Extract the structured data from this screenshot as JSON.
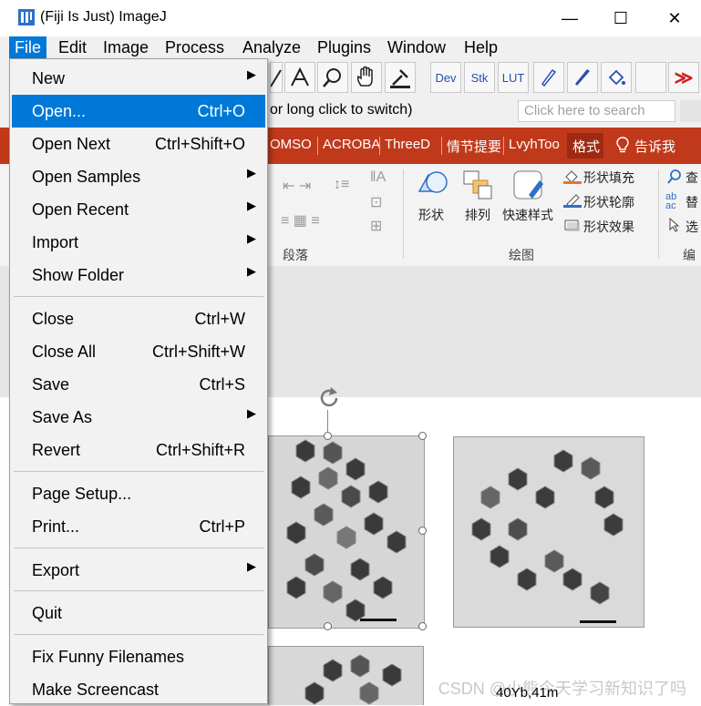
{
  "window": {
    "title": "(Fiji Is Just) ImageJ",
    "minimize": "—",
    "maximize": "☐",
    "close": "✕"
  },
  "menubar": [
    "File",
    "Edit",
    "Image",
    "Process",
    "Analyze",
    "Plugins",
    "Window",
    "Help"
  ],
  "toolbar": {
    "dev": "Dev",
    "stk": "Stk",
    "lut": "LUT",
    "status": "or long click to switch)",
    "search_placeholder": "Click here to search"
  },
  "ribbon_tabs": [
    "OMSO",
    "ACROBA",
    "ThreeD",
    "情节提要",
    "LvyhToo",
    "格式",
    "告诉我"
  ],
  "ribbon": {
    "paragraph_group": "段落",
    "drawing_group": "绘图",
    "edit_group": "编",
    "shape": "形状",
    "arrange": "排列",
    "quick_style": "快速样式",
    "shape_fill": "形状填充",
    "shape_outline": "形状轮廓",
    "shape_effects": "形状效果",
    "find": "查",
    "replace": "替",
    "select": "选"
  },
  "file_menu": {
    "items": [
      {
        "label": "New",
        "shortcut": "",
        "submenu": true
      },
      {
        "label": "Open...",
        "shortcut": "Ctrl+O",
        "submenu": false,
        "selected": true
      },
      {
        "label": "Open Next",
        "shortcut": "Ctrl+Shift+O",
        "submenu": false
      },
      {
        "label": "Open Samples",
        "shortcut": "",
        "submenu": true
      },
      {
        "label": "Open Recent",
        "shortcut": "",
        "submenu": true
      },
      {
        "label": "Import",
        "shortcut": "",
        "submenu": true
      },
      {
        "label": "Show Folder",
        "shortcut": "",
        "submenu": true
      },
      {
        "label": "Close",
        "shortcut": "Ctrl+W",
        "submenu": false
      },
      {
        "label": "Close All",
        "shortcut": "Ctrl+Shift+W",
        "submenu": false
      },
      {
        "label": "Save",
        "shortcut": "Ctrl+S",
        "submenu": false
      },
      {
        "label": "Save As",
        "shortcut": "",
        "submenu": true
      },
      {
        "label": "Revert",
        "shortcut": "Ctrl+Shift+R",
        "submenu": false
      },
      {
        "label": "Page Setup...",
        "shortcut": "",
        "submenu": false
      },
      {
        "label": "Print...",
        "shortcut": "Ctrl+P",
        "submenu": false
      },
      {
        "label": "Export",
        "shortcut": "",
        "submenu": true
      },
      {
        "label": "Quit",
        "shortcut": "",
        "submenu": false
      },
      {
        "label": "Fix Funny Filenames",
        "shortcut": "",
        "submenu": false
      },
      {
        "label": "Make Screencast",
        "shortcut": "",
        "submenu": false
      }
    ]
  },
  "watermark": "CSDN @小熊今天学习新知识了吗",
  "caption": "40Yb,41m",
  "colors": {
    "accent": "#0078d7",
    "ribbon_tab_bg": "#c0391b",
    "menu_bg": "#f2f2f2"
  }
}
